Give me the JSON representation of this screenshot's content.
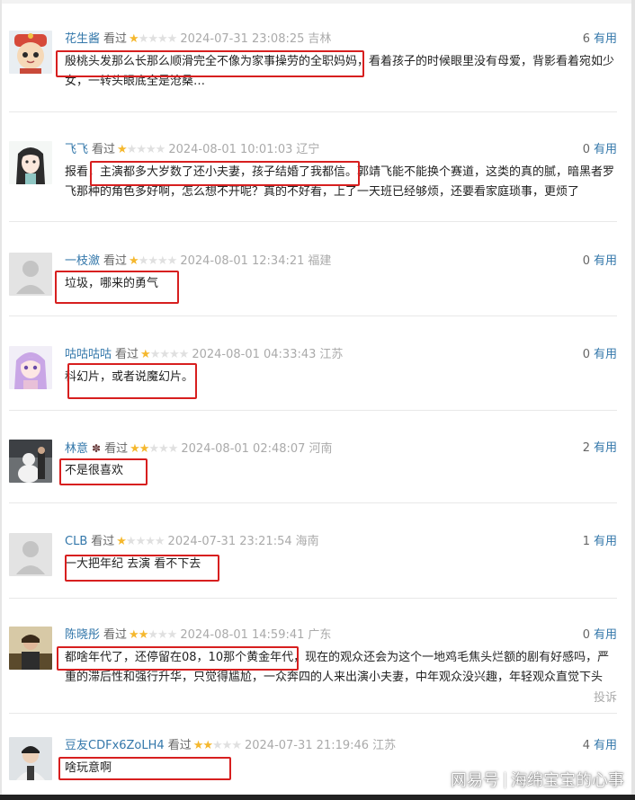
{
  "watched_label": "看过",
  "useful_label": "有用",
  "report_label": "投诉",
  "watermark": {
    "brand": "网易号",
    "account": "海绵宝宝的心事"
  },
  "colors": {
    "username": "#3377aa",
    "star": "#f5b82e",
    "highlight": "#d71f1f"
  },
  "comments": [
    {
      "user": "花生酱",
      "rating": 1,
      "time": "2024-07-31 23:08:25",
      "location": "吉林",
      "useful": "6",
      "text": "殷桃头发那么长那么顺滑完全不像为家事操劳的全职妈妈，看着孩子的时候眼里没有母爱，背影看着宛如少女，一转头眼底全是沧桑…",
      "avatar": "cartoon-cat-avatar"
    },
    {
      "user": "飞飞",
      "rating": 1,
      "time": "2024-08-01 10:01:03",
      "location": "辽宁",
      "useful": "0",
      "text": "报看，主演都多大岁数了还小夫妻，孩子结婚了我都信。郭靖飞能不能换个赛道，这类的真的腻，暗黑者罗飞那种的角色多好啊，怎么想不开呢？真的不好看，上了一天班已经够烦，还要看家庭琐事，更烦了",
      "avatar": "anime-girl-avatar"
    },
    {
      "user": "一枝瀲",
      "rating": 1,
      "time": "2024-08-01 12:34:21",
      "location": "福建",
      "useful": "0",
      "text": "垃圾，哪来的勇气",
      "avatar": "default-avatar"
    },
    {
      "user": "咕咕咕咕",
      "rating": 1,
      "time": "2024-08-01 04:33:43",
      "location": "江苏",
      "useful": "0",
      "text": "科幻片，或者说魔幻片。",
      "avatar": "anime-purple-hair-avatar"
    },
    {
      "user": "林意",
      "rating": 2,
      "time": "2024-08-01 02:48:07",
      "location": "河南",
      "useful": "2",
      "text": "不是很喜欢",
      "avatar": "snowman-photo-avatar"
    },
    {
      "user": "CLB",
      "rating": 1,
      "time": "2024-07-31 23:21:54",
      "location": "海南",
      "useful": "1",
      "text": "一大把年纪 去演 看不下去",
      "avatar": "default-avatar"
    },
    {
      "user": "陈晓彤",
      "rating": 2,
      "time": "2024-08-01 14:59:41",
      "location": "广东",
      "useful": "0",
      "text": "都啥年代了，还停留在08，10那个黄金年代，现在的观众还会为这个一地鸡毛焦头烂额的剧有好感吗，严重的滞后性和强行升华，只觉得尴尬，一众奔四的人来出演小夫妻，中年观众没兴趣，年轻观众直觉下头",
      "avatar": "person-photo-avatar"
    },
    {
      "user": "豆友CDFx6ZoLH4",
      "rating": 2,
      "time": "2024-07-31 21:19:46",
      "location": "江苏",
      "useful": "4",
      "text": "啥玩意啊",
      "avatar": "boy-photo-avatar"
    }
  ]
}
